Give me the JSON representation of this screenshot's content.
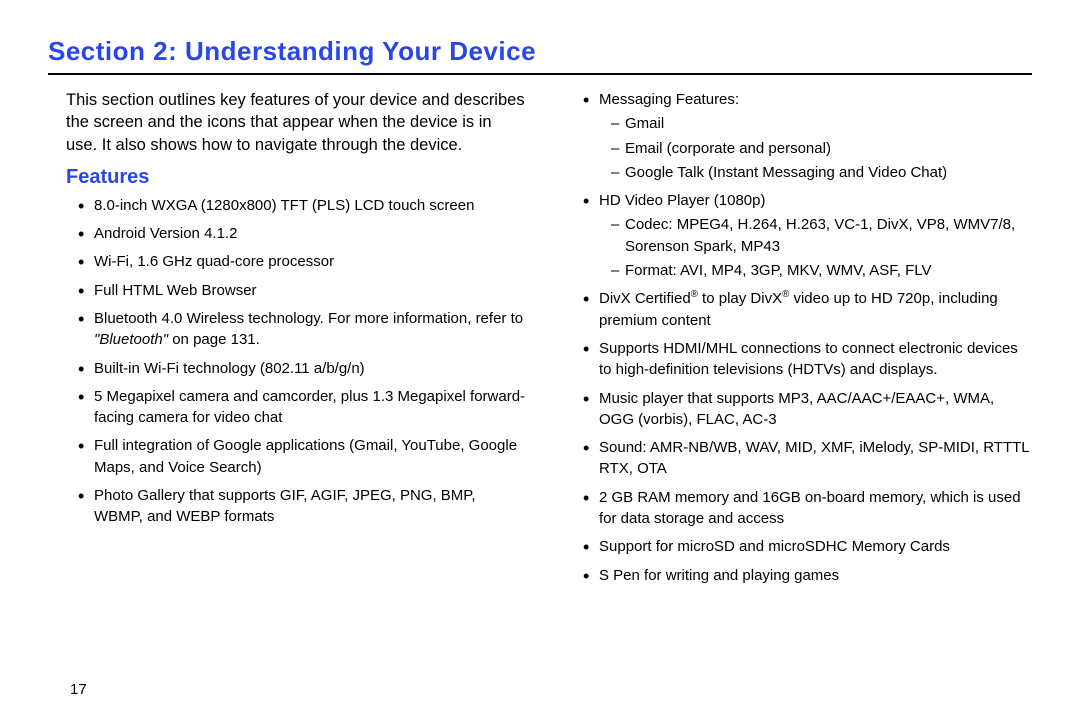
{
  "section_title": "Section 2: Understanding Your Device",
  "intro": "This section outlines key features of your device and describes the screen and the icons that appear when the device is in use. It also shows how to navigate through the device.",
  "subhead": "Features",
  "page_number": "17",
  "left": {
    "f1": "8.0-inch WXGA (1280x800) TFT (PLS) LCD touch screen",
    "f2": "Android Version 4.1.2",
    "f3": "Wi-Fi, 1.6 GHz quad-core processor",
    "f4": "Full HTML Web Browser",
    "f5a": "Bluetooth 4.0 Wireless technology. For more information, refer to ",
    "f5b": "\"Bluetooth\"",
    "f5c": " on page 131.",
    "f6": "Built-in Wi-Fi technology (802.11 a/b/g/n)",
    "f7": "5 Megapixel camera and camcorder, plus 1.3 Megapixel forward-facing camera for video chat",
    "f8": "Full integration of Google applications (Gmail, YouTube, Google Maps, and Voice Search)",
    "f9": "Photo Gallery that supports GIF, AGIF, JPEG, PNG, BMP, WBMP, and WEBP formats"
  },
  "right": {
    "m_head": "Messaging Features:",
    "m1": "Gmail",
    "m2": "Email (corporate and personal)",
    "m3": "Google Talk (Instant Messaging and Video Chat)",
    "hd_head": "HD Video Player (1080p)",
    "hd1": "Codec: MPEG4, H.264, H.263, VC-1, DivX, VP8, WMV7/8, Sorenson Spark, MP43",
    "hd2": "Format: AVI, MP4, 3GP, MKV, WMV, ASF, FLV",
    "divx_a": "DivX Certified",
    "divx_b": " to play DivX",
    "divx_c": " video up to HD 720p, including premium content",
    "reg": "®",
    "hdmi": "Supports HDMI/MHL connections to connect electronic devices to high-definition televisions (HDTVs) and displays.",
    "music": "Music player that supports MP3, AAC/AAC+/EAAC+, WMA, OGG (vorbis), FLAC, AC-3",
    "sound": "Sound: AMR-NB/WB, WAV, MID, XMF, iMelody, SP-MIDI, RTTTL RTX, OTA",
    "ram": "2 GB RAM memory and 16GB on-board memory, which is used for data storage and access",
    "sd": "Support for microSD and microSDHC Memory Cards",
    "spen": "S Pen for writing and playing games"
  }
}
